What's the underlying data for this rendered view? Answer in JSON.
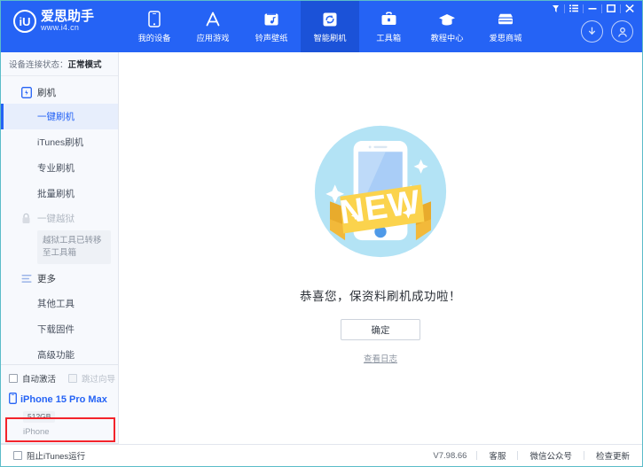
{
  "brand": {
    "logo_letters": "iU",
    "name": "爱思助手",
    "url": "www.i4.cn"
  },
  "nav": {
    "tabs": [
      {
        "label": "我的设备",
        "icon": "phone-icon",
        "active": false
      },
      {
        "label": "应用游戏",
        "icon": "appstore-icon",
        "active": false
      },
      {
        "label": "铃声壁纸",
        "icon": "music-icon",
        "active": false
      },
      {
        "label": "智能刷机",
        "icon": "refresh-icon",
        "active": true
      },
      {
        "label": "工具箱",
        "icon": "toolbox-icon",
        "active": false
      },
      {
        "label": "教程中心",
        "icon": "graduation-cap-icon",
        "active": false
      },
      {
        "label": "爱思商城",
        "icon": "store-icon",
        "active": false
      }
    ],
    "window_controls": [
      "pin-icon",
      "menu-icon",
      "minimize-icon",
      "maximize-icon",
      "close-icon"
    ],
    "account_buttons": [
      "download-icon",
      "user-account-icon"
    ]
  },
  "sidebar": {
    "device_status_label": "设备连接状态：",
    "device_status_value": "正常模式",
    "groups": [
      {
        "label": "刷机",
        "icon": "flash-device-icon",
        "dim": false,
        "items": [
          {
            "label": "一键刷机",
            "active": true
          },
          {
            "label": "iTunes刷机",
            "active": false
          },
          {
            "label": "专业刷机",
            "active": false
          },
          {
            "label": "批量刷机",
            "active": false
          }
        ]
      },
      {
        "label": "一键越狱",
        "icon": "lock-icon",
        "dim": true,
        "tooltip": "越狱工具已转移至工具箱",
        "items": []
      },
      {
        "label": "更多",
        "icon": "list-menu-icon",
        "dim": false,
        "items": [
          {
            "label": "其他工具",
            "active": false
          },
          {
            "label": "下载固件",
            "active": false
          },
          {
            "label": "高级功能",
            "active": false
          }
        ]
      }
    ],
    "options": [
      {
        "label": "自动激活",
        "checked": false,
        "disabled": false
      },
      {
        "label": "跳过向导",
        "checked": false,
        "disabled": true
      }
    ],
    "device": {
      "name": "iPhone 15 Pro Max",
      "capacity": "512GB",
      "type": "iPhone",
      "icon": "phone-small-icon"
    }
  },
  "main": {
    "illustration": "new-phone-badge-illustration",
    "illustration_label": "NEW",
    "success_message": "恭喜您，保资料刷机成功啦！",
    "confirm_label": "确定",
    "view_log_label": "查看日志"
  },
  "footer": {
    "block_itunes_label": "阻止iTunes运行",
    "block_itunes_checked": false,
    "version": "V7.98.66",
    "links": [
      "客服",
      "微信公众号",
      "检查更新"
    ]
  },
  "colors": {
    "brand_blue": "#2563f5",
    "active_tab_blue": "#1b52d8",
    "sidebar_bg": "#f7f9fd",
    "sidebar_active_bg": "#e7eefc",
    "highlight_red": "#f3232b",
    "badge_yellow": "#fbd34d",
    "illustration_blue": "#b3e3f5"
  },
  "annotation": {
    "red_highlight_region": "auto-activate-options-row"
  }
}
